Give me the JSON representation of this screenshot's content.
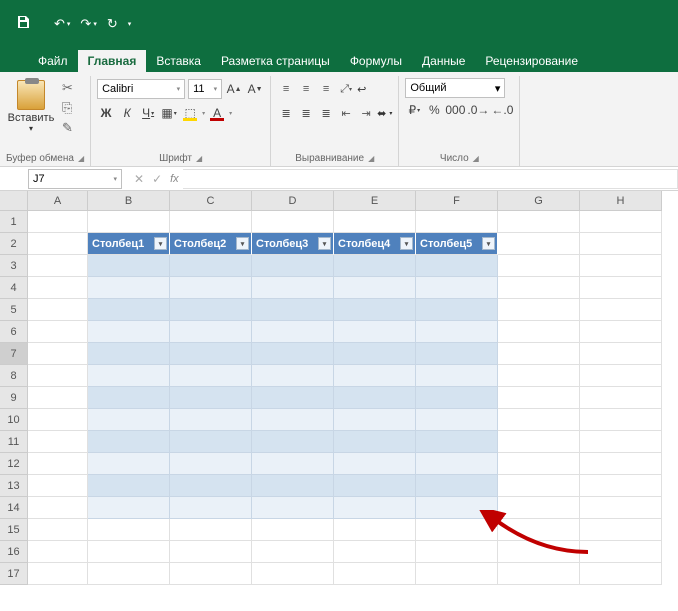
{
  "tabs": {
    "file": "Файл",
    "home": "Главная",
    "insert": "Вставка",
    "layout": "Разметка страницы",
    "formulas": "Формулы",
    "data": "Данные",
    "review": "Рецензирование"
  },
  "ribbon": {
    "clipboard": {
      "paste": "Вставить",
      "label": "Буфер обмена"
    },
    "font": {
      "name": "Calibri",
      "size": "11",
      "label": "Шрифт"
    },
    "alignment": {
      "label": "Выравнивание"
    },
    "number": {
      "format": "Общий",
      "label": "Число"
    }
  },
  "namebox": "J7",
  "columns": [
    "A",
    "B",
    "C",
    "D",
    "E",
    "F",
    "G",
    "H"
  ],
  "rows": [
    "1",
    "2",
    "3",
    "4",
    "5",
    "6",
    "7",
    "8",
    "9",
    "10",
    "11",
    "12",
    "13",
    "14",
    "15",
    "16",
    "17"
  ],
  "table": {
    "headers": [
      "Столбец1",
      "Столбец2",
      "Столбец3",
      "Столбец4",
      "Столбец5"
    ]
  }
}
